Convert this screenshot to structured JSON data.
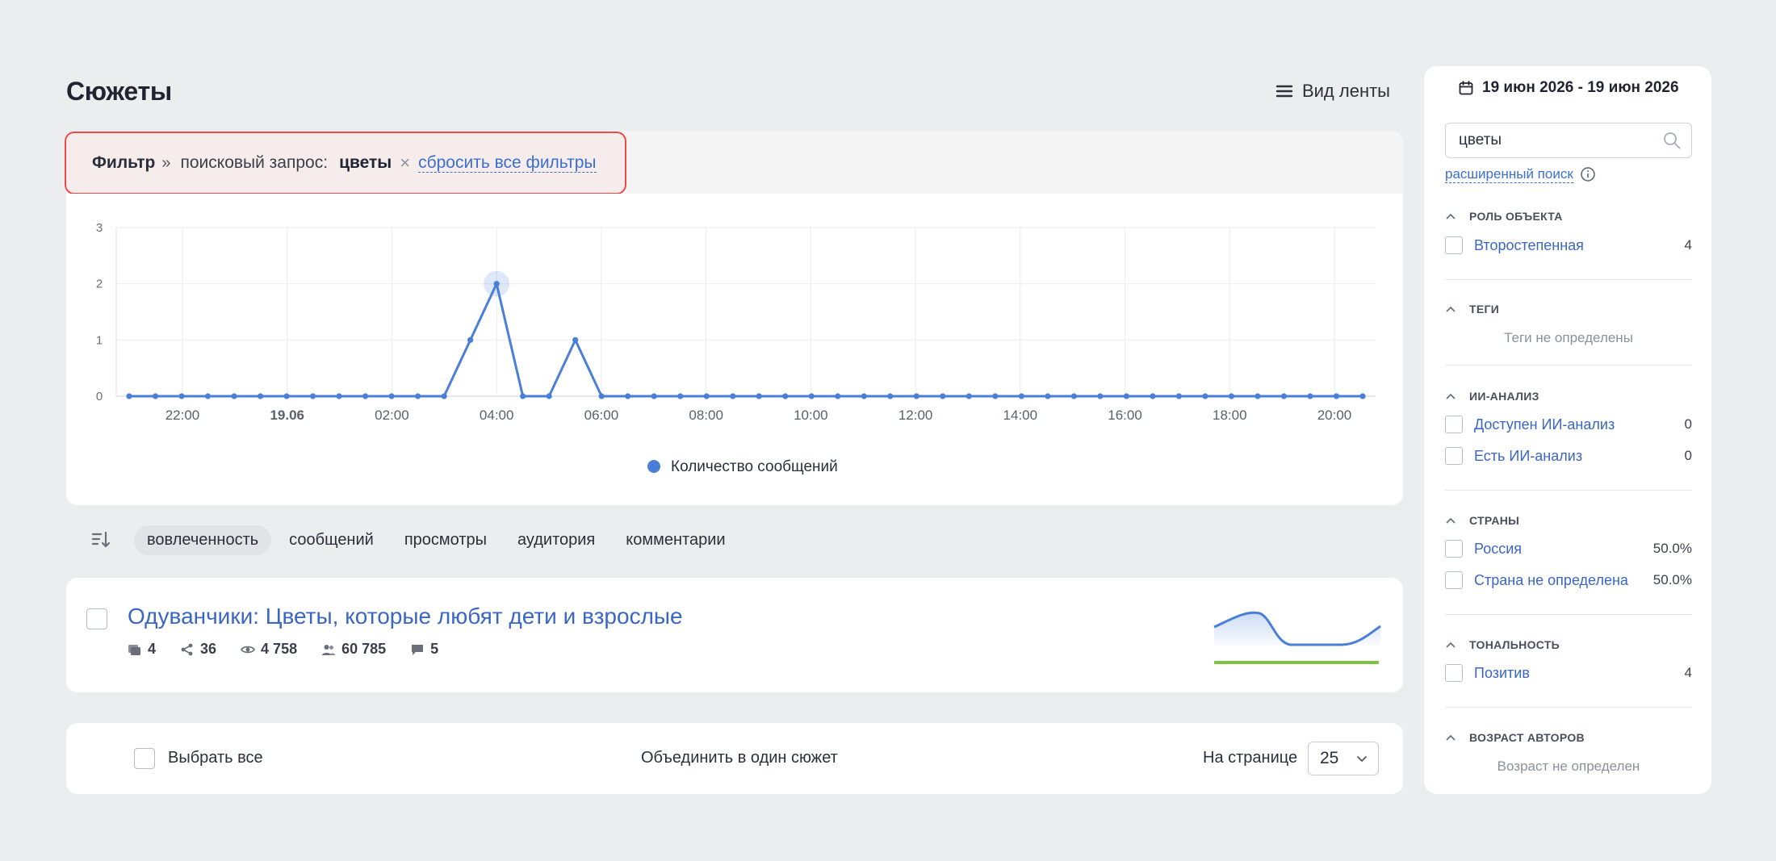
{
  "header": {
    "title": "Сюжеты",
    "feed_view_label": "Вид ленты"
  },
  "filter": {
    "label": "Фильтр",
    "separator": "»",
    "key": "поисковый запрос:",
    "value": "цветы",
    "remove_symbol": "×",
    "reset_label": "сбросить все фильтры",
    "highlight_color": "#ee4a4a"
  },
  "chart_data": {
    "type": "line",
    "y_ticks": [
      "0",
      "1",
      "2",
      "3"
    ],
    "ylim": [
      0,
      3
    ],
    "x_tick_labels": [
      "22:00",
      "19.06",
      "02:00",
      "04:00",
      "06:00",
      "08:00",
      "10:00",
      "12:00",
      "14:00",
      "16:00",
      "18:00",
      "20:00"
    ],
    "x_tick_bold": "19.06",
    "values": [
      0,
      0,
      0,
      0,
      0,
      0,
      0,
      0,
      0,
      0,
      0,
      0,
      0,
      1,
      2,
      0,
      0,
      1,
      0,
      0,
      0,
      0,
      0,
      0,
      0,
      0,
      0,
      0,
      0,
      0,
      0,
      0,
      0,
      0,
      0,
      0,
      0,
      0,
      0,
      0,
      0,
      0,
      0,
      0,
      0,
      0,
      0,
      0
    ],
    "highlighted_index": 14,
    "grid": true,
    "series_color": "#4a7fd9",
    "legend": "Количество сообщений"
  },
  "sort": {
    "options": [
      "вовлеченность",
      "сообщений",
      "просмотры",
      "аудитория",
      "комментарии"
    ],
    "active": "вовлеченность"
  },
  "story": {
    "title": "Одуванчики: Цветы, которые любят дети и взрослые",
    "stats": {
      "messages": "4",
      "shares": "36",
      "views": "4 758",
      "audience": "60 785",
      "comments": "5"
    },
    "sparkline_color": "#4a7fd9",
    "sentiment_bar_color": "#7cc243"
  },
  "bottom": {
    "select_all": "Выбрать все",
    "merge": "Объединить в один сюжет",
    "per_page_label": "На странице",
    "per_page_value": "25"
  },
  "sidebar": {
    "date_range": "19 июн 2026 - 19 июн 2026",
    "search_value": "цветы",
    "advanced_search": "расширенный поиск",
    "sections": {
      "role": {
        "title": "РОЛЬ ОБЪЕКТА",
        "items": [
          {
            "label": "Второстепенная",
            "count": "4"
          }
        ]
      },
      "tags": {
        "title": "ТЕГИ",
        "empty": "Теги не определены"
      },
      "ai": {
        "title": "ИИ-АНАЛИЗ",
        "items": [
          {
            "label": "Доступен ИИ-анализ",
            "count": "0"
          },
          {
            "label": "Есть ИИ-анализ",
            "count": "0"
          }
        ]
      },
      "countries": {
        "title": "СТРАНЫ",
        "items": [
          {
            "label": "Россия",
            "count": "50.0%"
          },
          {
            "label": "Страна не определена",
            "count": "50.0%"
          }
        ]
      },
      "tone": {
        "title": "ТОНАЛЬНОСТЬ",
        "items": [
          {
            "label": "Позитив",
            "count": "4"
          }
        ]
      },
      "age": {
        "title": "ВОЗРАСТ АВТОРОВ",
        "empty": "Возраст не определен"
      }
    }
  }
}
